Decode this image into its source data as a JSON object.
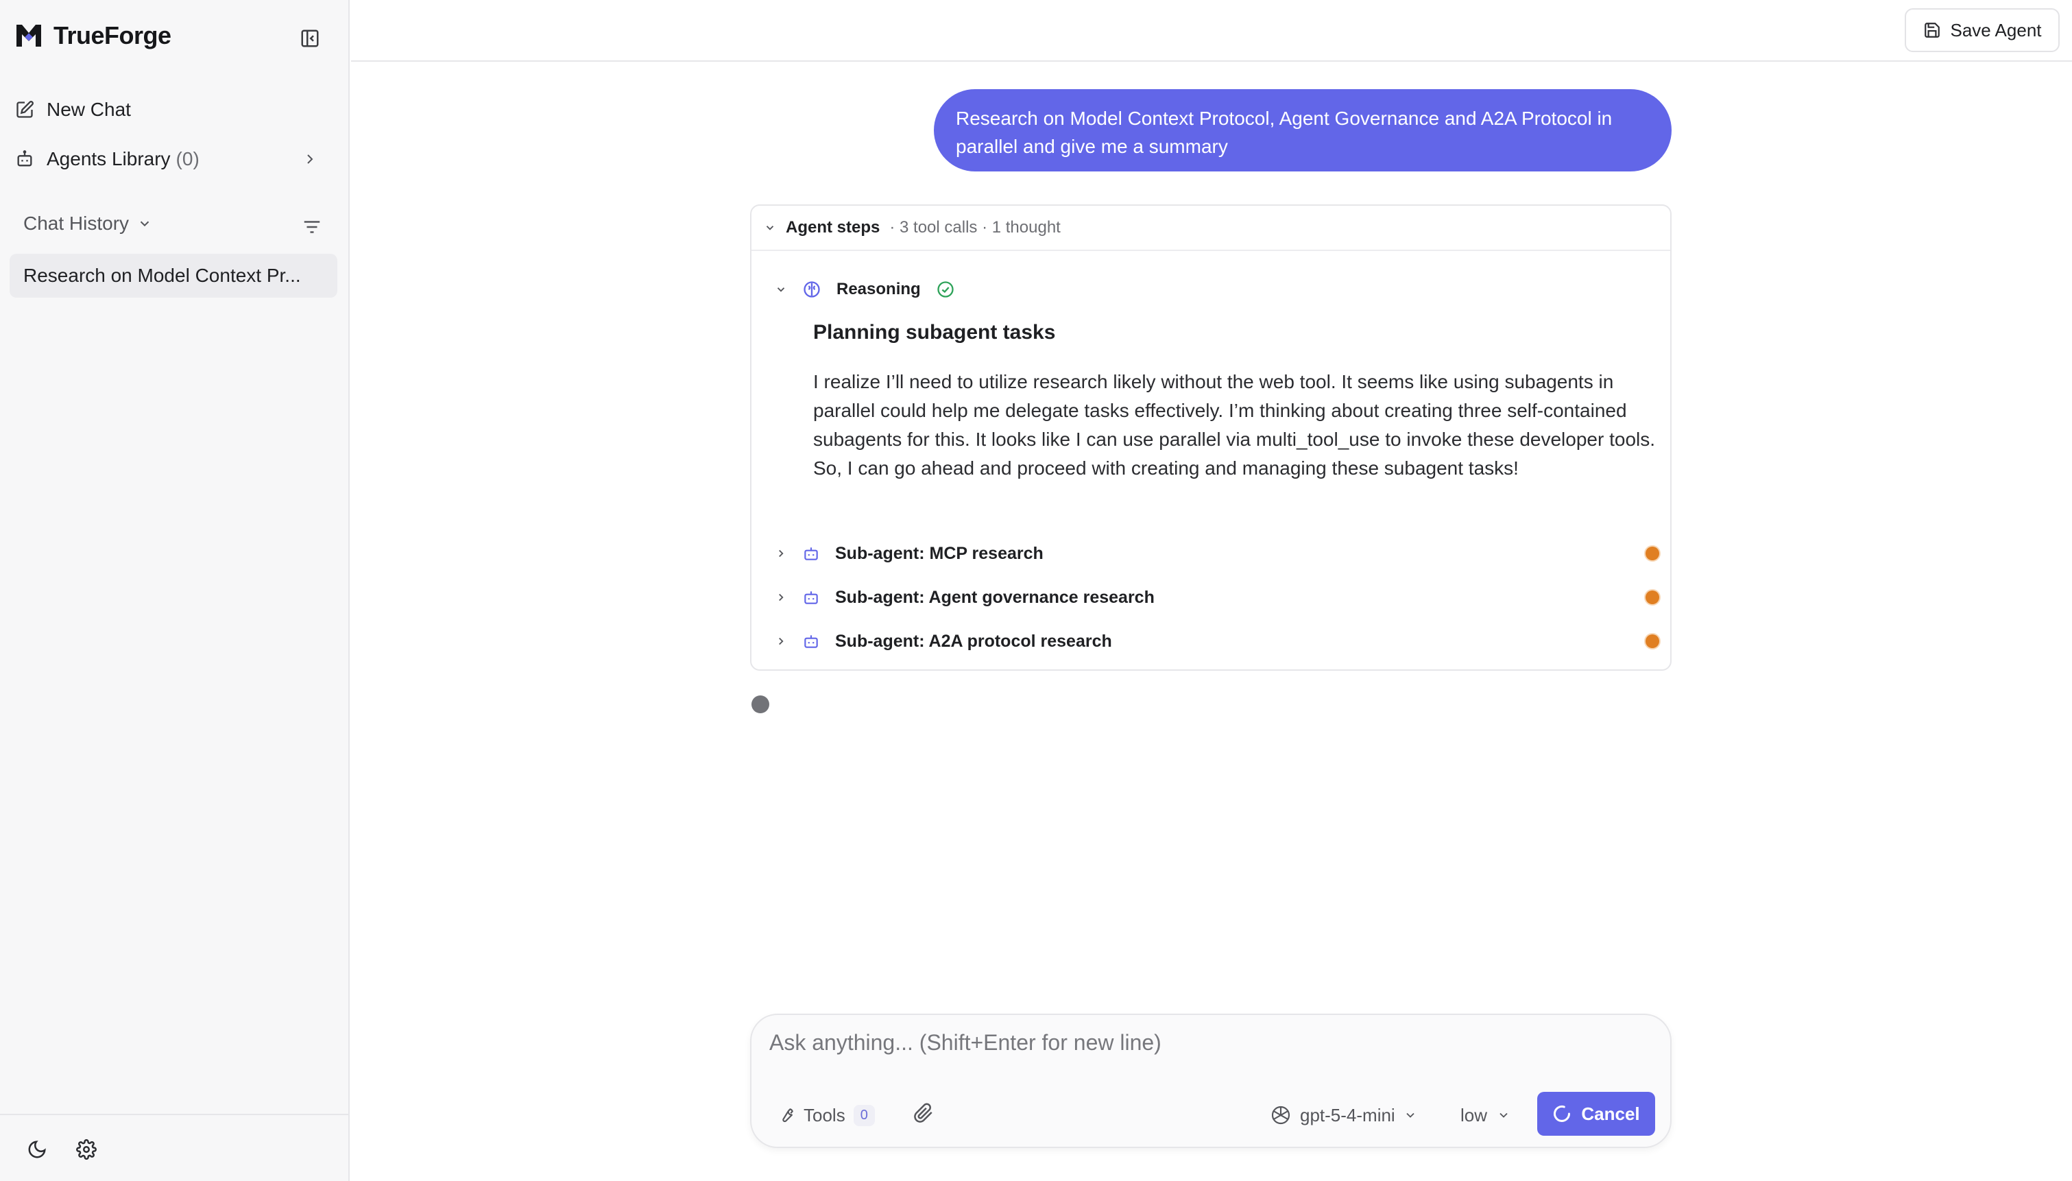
{
  "brand": {
    "name": "TrueForge",
    "logo_icon": "trueforge-logo-icon"
  },
  "sidebar": {
    "new_chat_label": "New Chat",
    "agents_library_label": "Agents Library",
    "agents_library_count": "(0)",
    "chat_history_label": "Chat History",
    "history_items": [
      "Research on Model Context Pr..."
    ]
  },
  "topbar": {
    "save_agent_label": "Save Agent"
  },
  "conversation": {
    "user_message": "Research on Model Context Protocol, Agent Governance and A2A Protocol in parallel and give me a summary",
    "agent_steps": {
      "title": "Agent steps",
      "meta": "· 3 tool calls · 1 thought",
      "reasoning_label": "Reasoning",
      "reasoning_title": "Planning subagent tasks",
      "reasoning_text": "I realize I’ll need to utilize research likely without the web tool. It seems like using subagents in parallel could help me delegate tasks effectively. I’m thinking about creating three self-contained subagents for this. It looks like I can use parallel via multi_tool_use to invoke these developer tools. So, I can go ahead and proceed with creating and managing these subagent tasks!",
      "subagents": [
        {
          "label": "Sub-agent: MCP research"
        },
        {
          "label": "Sub-agent: Agent governance research"
        },
        {
          "label": "Sub-agent: A2A protocol research"
        }
      ]
    }
  },
  "composer": {
    "placeholder": "Ask anything... (Shift+Enter for new line)",
    "value": "",
    "tools_label": "Tools",
    "tools_count": "0",
    "model": "gpt-5-4-mini",
    "effort": "low",
    "cancel_label": "Cancel"
  },
  "colors": {
    "accent": "#6266e8",
    "status_running": "#e07f22",
    "success": "#2fa35a",
    "sidebar_bg": "#f7f7f8"
  }
}
